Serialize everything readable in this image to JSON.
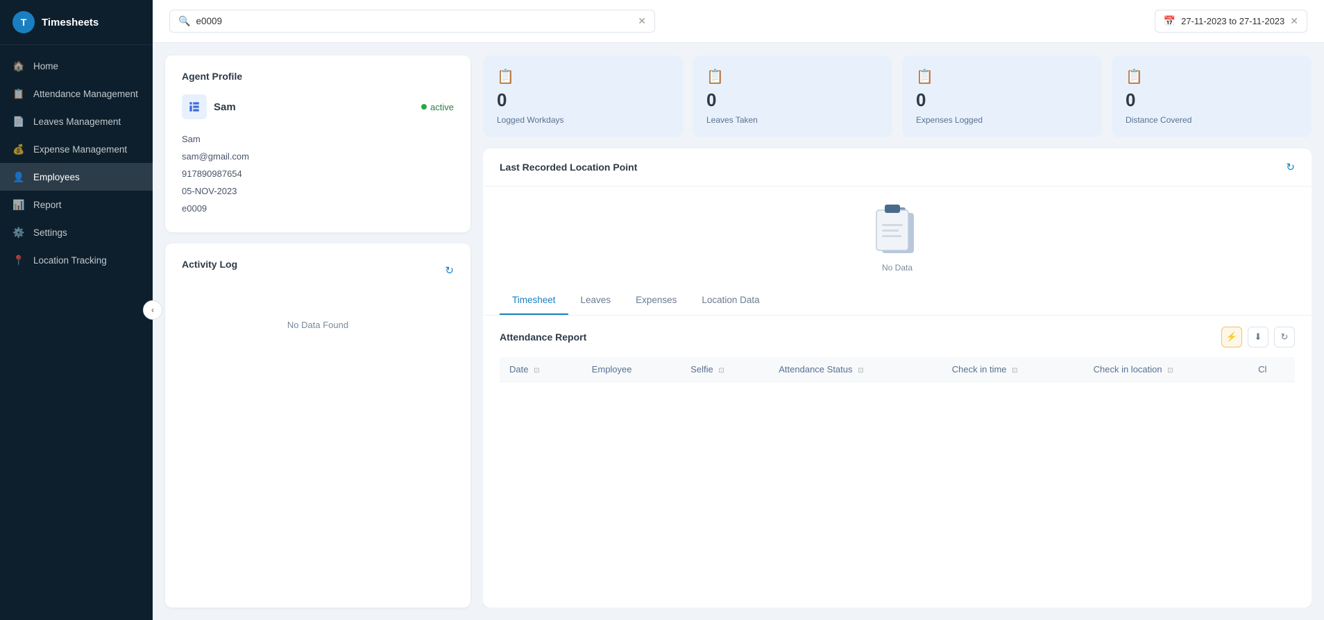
{
  "app": {
    "name": "Timesheets"
  },
  "sidebar": {
    "items": [
      {
        "id": "home",
        "label": "Home",
        "icon": "🏠",
        "active": false
      },
      {
        "id": "attendance",
        "label": "Attendance Management",
        "icon": "📋",
        "active": false
      },
      {
        "id": "leaves",
        "label": "Leaves Management",
        "icon": "📄",
        "active": false
      },
      {
        "id": "expense",
        "label": "Expense Management",
        "icon": "💰",
        "active": false
      },
      {
        "id": "employees",
        "label": "Employees",
        "icon": "👤",
        "active": true
      },
      {
        "id": "report",
        "label": "Report",
        "icon": "📊",
        "active": false
      },
      {
        "id": "settings",
        "label": "Settings",
        "icon": "⚙️",
        "active": false
      },
      {
        "id": "location",
        "label": "Location Tracking",
        "icon": "📍",
        "active": false
      }
    ]
  },
  "topbar": {
    "search": {
      "value": "e0009",
      "placeholder": "Search..."
    },
    "date_range": {
      "value": "27-11-2023 to 27-11-2023"
    }
  },
  "agent_profile": {
    "title": "Agent Profile",
    "name": "Sam",
    "email": "sam@gmail.com",
    "phone": "917890987654",
    "join_date": "05-NOV-2023",
    "employee_id": "e0009",
    "status": "active"
  },
  "stats": [
    {
      "id": "logged_workdays",
      "label": "Logged Workdays",
      "value": "0",
      "icon": "📋"
    },
    {
      "id": "leaves_taken",
      "label": "Leaves Taken",
      "value": "0",
      "icon": "📋"
    },
    {
      "id": "expenses_logged",
      "label": "Expenses Logged",
      "value": "0",
      "icon": "📋"
    },
    {
      "id": "distance_covered",
      "label": "Distance Covered",
      "value": "0",
      "icon": "📋"
    }
  ],
  "location_section": {
    "title": "Last Recorded Location Point",
    "no_data_label": "No Data"
  },
  "activity_log": {
    "title": "Activity Log",
    "no_data_text": "No Data Found"
  },
  "tabs": [
    {
      "id": "timesheet",
      "label": "Timesheet",
      "active": true
    },
    {
      "id": "leaves",
      "label": "Leaves",
      "active": false
    },
    {
      "id": "expenses",
      "label": "Expenses",
      "active": false
    },
    {
      "id": "location_data",
      "label": "Location Data",
      "active": false
    }
  ],
  "attendance_report": {
    "title": "Attendance Report",
    "columns": [
      {
        "id": "date",
        "label": "Date"
      },
      {
        "id": "employee",
        "label": "Employee"
      },
      {
        "id": "selfie",
        "label": "Selfie"
      },
      {
        "id": "attendance_status",
        "label": "Attendance Status"
      },
      {
        "id": "check_in_time",
        "label": "Check in time"
      },
      {
        "id": "check_in_location",
        "label": "Check in location"
      },
      {
        "id": "cl",
        "label": "Cl"
      }
    ],
    "rows": []
  }
}
